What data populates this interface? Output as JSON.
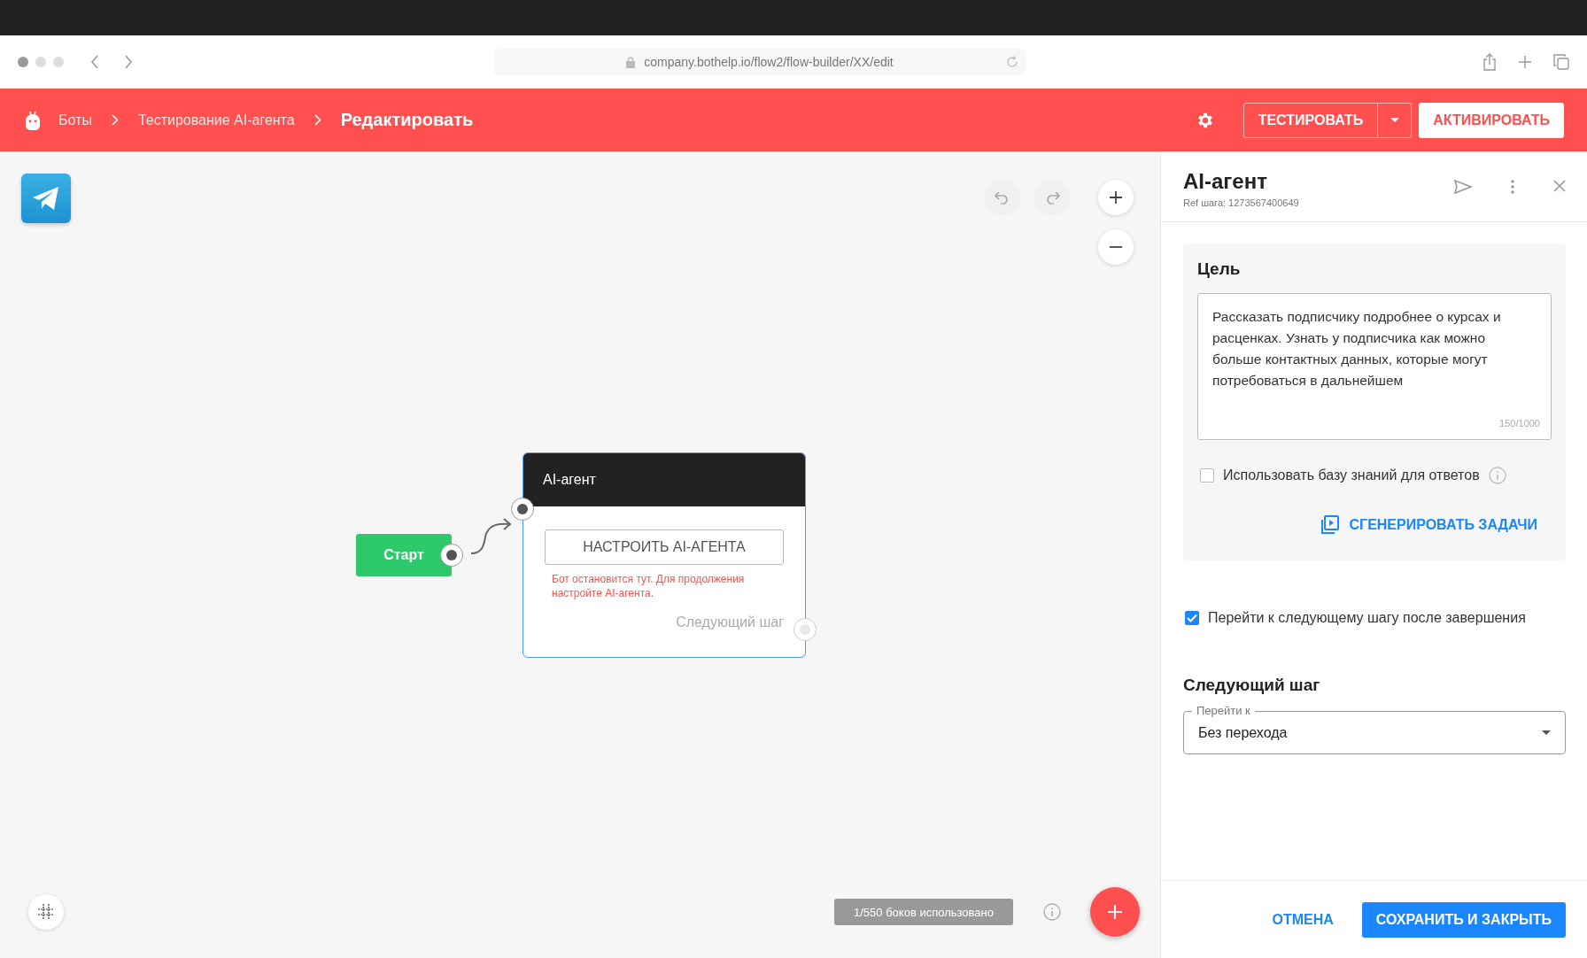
{
  "browser": {
    "url": "company.bothelp.io/flow2/flow-builder/XX/edit"
  },
  "header": {
    "breadcrumbs": [
      {
        "label": "Боты"
      },
      {
        "label": "Тестирование AI-агента"
      }
    ],
    "current": "Редактировать",
    "test_button": "ТЕСТИРОВАТЬ",
    "activate_button": "АКТИВИРОВАТЬ"
  },
  "canvas": {
    "start_node": {
      "label": "Старт"
    },
    "agent_node": {
      "title": "AI-агент",
      "button": "НАСТРОИТЬ AI-АГЕНТА",
      "warning": "Бот остановится тут. Для продолжения настройте AI-агента.",
      "next_label": "Следующий шаг"
    },
    "usage": "1/550 боков использовано"
  },
  "panel": {
    "title": "AI-агент",
    "ref": "Ref шага: 1273567400649",
    "goal": {
      "heading": "Цель",
      "text": "Рассказать подписчику подробнее о курсах и расценках. Узнать у подписчика как можно больше контактных данных, которые могут потребоваться в дальнейшем",
      "counter": "150/1000"
    },
    "knowledge_checkbox": {
      "label": "Использовать базу знаний для ответов",
      "checked": false
    },
    "generate_button": "СГЕНЕРИРОВАТЬ ЗАДАЧИ",
    "next_checkbox": {
      "label": "Перейти к следующему шагу после завершения",
      "checked": true
    },
    "next_step": {
      "heading": "Следующий шаг",
      "select_label": "Перейти к",
      "select_value": "Без перехода"
    },
    "cancel_button": "ОТМЕНА",
    "save_button": "СОХРАНИТЬ И ЗАКРЫТЬ"
  }
}
